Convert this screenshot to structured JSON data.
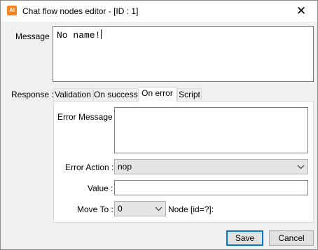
{
  "window": {
    "title": "Chat flow nodes editor - [ID : 1]",
    "app_icon_text": "AI",
    "close_glyph": "✕"
  },
  "message": {
    "label": "Message :",
    "value": "No name!"
  },
  "response": {
    "label": "Response :",
    "tabs": [
      {
        "label": "Validation",
        "active": false
      },
      {
        "label": "On success",
        "active": false
      },
      {
        "label": "On error",
        "active": true
      },
      {
        "label": "Script",
        "active": false
      }
    ]
  },
  "on_error": {
    "error_message_label": "Error Message :",
    "error_message_value": "",
    "error_action_label": "Error Action :",
    "error_action_value": "nop",
    "value_label": "Value :",
    "value_value": "",
    "move_to_label": "Move To :",
    "move_to_value": "0",
    "node_label": "Node [id=?]:"
  },
  "footer": {
    "save_label": "Save",
    "cancel_label": "Cancel"
  },
  "colors": {
    "accent": "#0078d7",
    "app_icon": "#f5821f"
  }
}
